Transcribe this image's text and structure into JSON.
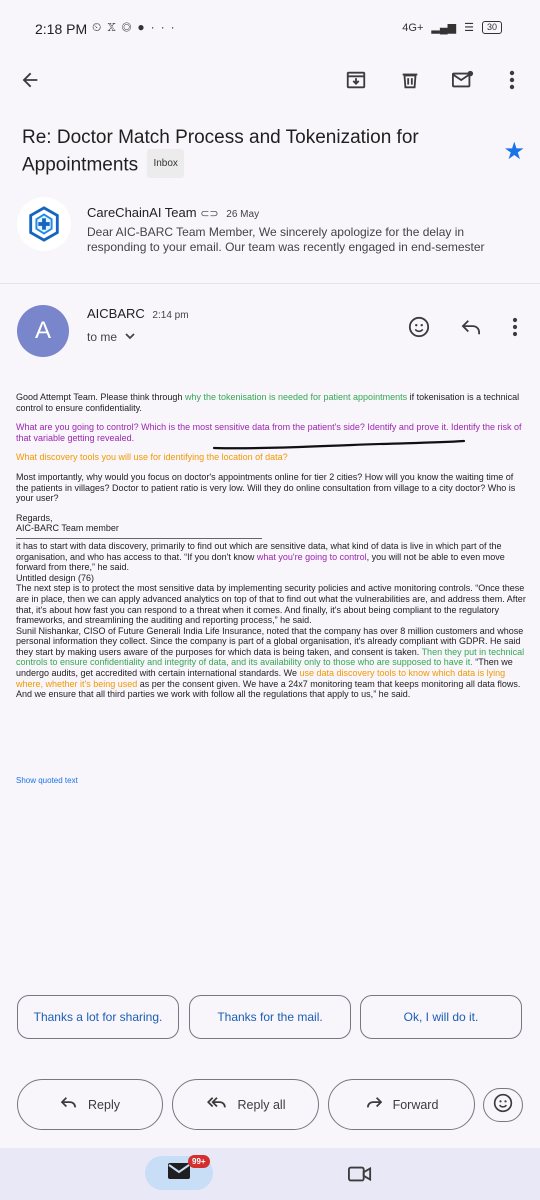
{
  "status_bar": {
    "time": "2:18 PM",
    "left_icons": [
      "alarm-icon",
      "x-icon",
      "instagram-icon",
      "jio-icon",
      "more-dots-icon"
    ],
    "network": "4G+",
    "battery": "30"
  },
  "toolbar": {
    "icons": [
      "back-arrow-icon",
      "archive-icon",
      "delete-icon",
      "mark-unread-icon",
      "more-vert-icon"
    ]
  },
  "email": {
    "subject": "Re: Doctor Match Process and Tokenization for Appointments",
    "label": "Inbox",
    "starred": true
  },
  "message1": {
    "sender": "CareChainAI Team",
    "date": "26 May",
    "snippet": "Dear AIC-BARC Team Member, We sincerely apologize for the delay in responding to your email. Our team was recently engaged in end-semester"
  },
  "message2": {
    "avatar_letter": "A",
    "sender": "AICBARC",
    "time": "2:14 pm",
    "to": "to me",
    "avatar_color": "#7986cb"
  },
  "body": {
    "p1_a": "Good Attempt Team. Please think through ",
    "p1_green": "why the tokenisation is needed for patient appointments",
    "p1_b": " if tokenisation is a technical control to ensure confidentiality.",
    "p2_purple": "What are you going to control? Which is the most sensitive data from the patient's side? Identify and prove it. Identify the risk of that variable getting revealed.",
    "p3_orange": "What discovery tools you will use for identifying the location of data?",
    "p4": "Most importantly, why would you focus on doctor's appointments online for tier 2 cities? How will you know the waiting time of the patients in villages? Doctor to patient ratio is very low. Will they do online consultation from village to a city doctor? Who is your user?",
    "regards": "Regards,",
    "signature": "AIC-BARC Team member",
    "q1_a": "it has to start with data discovery, primarily to find out which are sensitive data, what kind of data is live in which part of the organisation, and who has access to that. “If you don't know ",
    "q1_purple": "what you're going to control",
    "q1_b": ", you will not be able to even move forward from there,” he said.",
    "q2": "Untitled design (76)",
    "q3": "The next step is to protect the most sensitive data by implementing security policies and active monitoring controls. “Once these are in place, then we can apply advanced analytics on top of that to find out what the vulnerabilities are, and address them. After that, it's about how fast you can respond to a threat when it comes. And finally, it's about being compliant to the regulatory frameworks, and streamlining the auditing and reporting process,” he said.",
    "q4_a": "Sunil Nishankar, CISO of Future Generali India Life Insurance, noted that the company has over 8 million customers and whose personal information they collect. Since the company is part of a global organisation, it's already compliant with GDPR. He said they start by making users aware of the purposes for which data is being taken, and consent is taken. ",
    "q4_green": "Then they put in technical controls to ensure confidentiality and integrity of data, and its availability only to those who are supposed to have it.",
    "q4_b": " “Then we undergo audits, get accredited with certain international standards. We ",
    "q4_orange": "use data discovery tools to know which data is lying where, whether it's being used",
    "q4_c": " as per the consent given. We have a 24x7 monitoring team that keeps monitoring all data flows. And we ensure that all third parties we work with follow all the regulations that apply to us,” he said.",
    "show_quoted": "Show quoted text"
  },
  "smart_replies": [
    "Thanks a lot for sharing.",
    "Thanks for the mail.",
    "Ok, I will do it."
  ],
  "actions": {
    "reply": "Reply",
    "reply_all": "Reply all",
    "forward": "Forward"
  },
  "bottom_nav": {
    "mail_badge": "99+"
  },
  "colors": {
    "accent": "#1a73e8",
    "green_text": "#34a853",
    "purple_text": "#9c27b0",
    "orange_text": "#f29900"
  }
}
